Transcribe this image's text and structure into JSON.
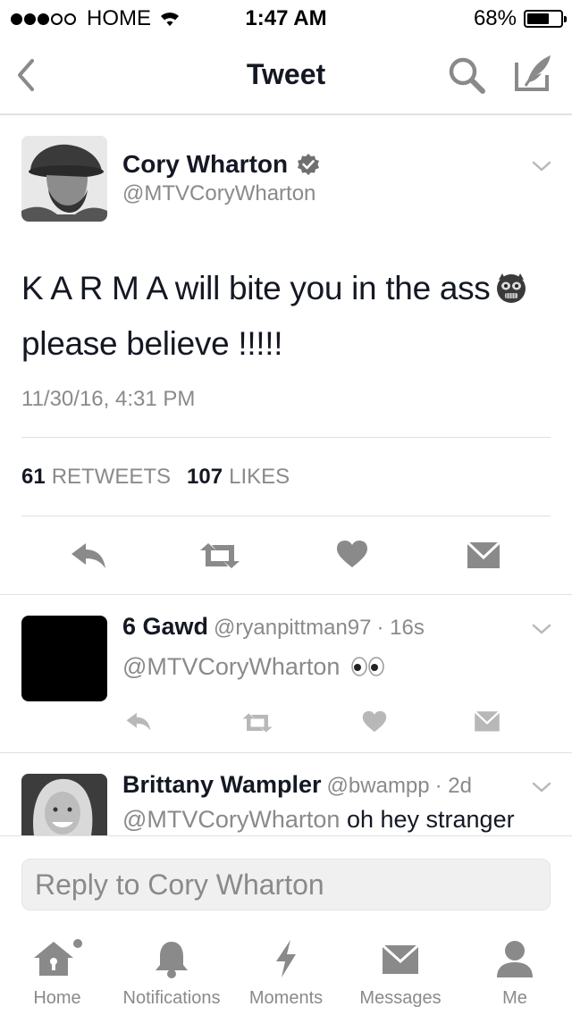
{
  "status_bar": {
    "carrier": "HOME",
    "time": "1:47 AM",
    "battery": "68%",
    "battery_level": 0.68
  },
  "nav": {
    "title": "Tweet",
    "icons": [
      "back-icon",
      "search-icon",
      "compose-icon"
    ]
  },
  "tweet": {
    "author_name": "Cory Wharton",
    "author_handle": "@MTVCoryWharton",
    "text_line1": "K A R M A will bite you in the ass",
    "text_line2": "please believe !!!!!",
    "date": "11/30/16, 4:31 PM",
    "retweet_count": "61",
    "retweet_label": "RETWEETS",
    "like_count": "107",
    "like_label": "LIKES",
    "actions": [
      "reply-icon",
      "retweet-icon",
      "like-icon",
      "message-icon"
    ]
  },
  "replies": [
    {
      "name": "6 Gawd",
      "handle": "@ryanpittman97",
      "time": "· 16s",
      "mention": "@MTVCoryWharton",
      "text": ""
    },
    {
      "name": "Brittany Wampler",
      "handle": "@bwampp",
      "time": "· 2d",
      "mention": "@MTVCoryWharton",
      "text": "oh hey stranger"
    }
  ],
  "reply_box": {
    "placeholder": "Reply to Cory Wharton"
  },
  "tabs": [
    {
      "label": "Home",
      "icon": "home-icon"
    },
    {
      "label": "Notifications",
      "icon": "bell-icon"
    },
    {
      "label": "Moments",
      "icon": "lightning-icon"
    },
    {
      "label": "Messages",
      "icon": "envelope-icon"
    },
    {
      "label": "Me",
      "icon": "person-icon"
    }
  ]
}
